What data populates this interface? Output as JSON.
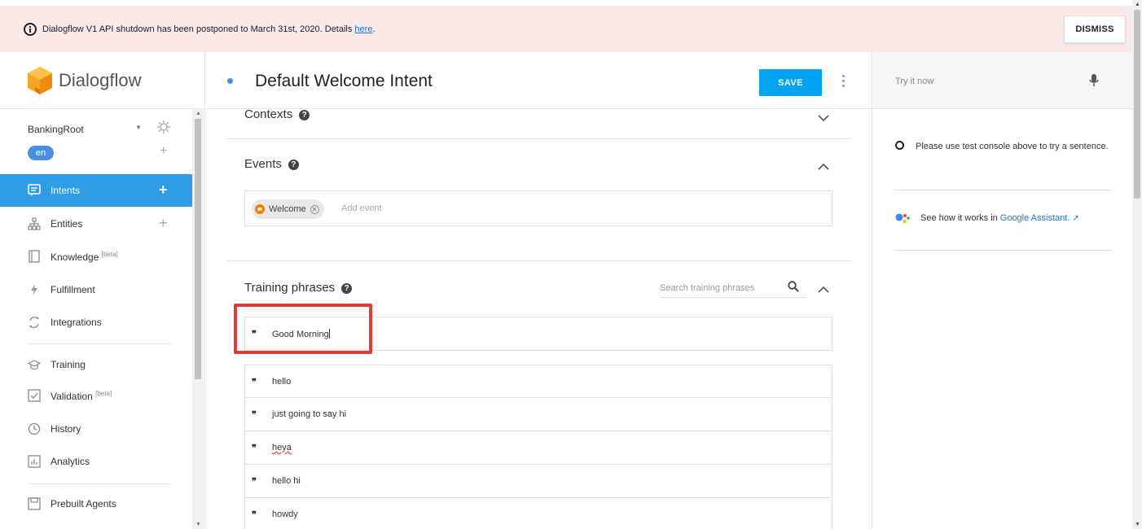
{
  "banner": {
    "message": "Dialogflow V1 API shutdown has been postponed to March 31st, 2020. Details",
    "link": "here",
    "dismiss": "DISMISS"
  },
  "sidebar": {
    "brand": "Dialogflow",
    "agent": "BankingRoot",
    "language": "en",
    "items": [
      {
        "label": "Intents",
        "icon": "intents-icon",
        "sup": ""
      },
      {
        "label": "Entities",
        "icon": "entities-icon",
        "sup": ""
      },
      {
        "label": "Knowledge",
        "icon": "knowledge-icon",
        "sup": "[beta]"
      },
      {
        "label": "Fulfillment",
        "icon": "fulfillment-icon",
        "sup": ""
      },
      {
        "label": "Integrations",
        "icon": "integrations-icon",
        "sup": ""
      },
      {
        "label": "Training",
        "icon": "training-icon",
        "sup": ""
      },
      {
        "label": "Validation",
        "icon": "validation-icon",
        "sup": "[beta]"
      },
      {
        "label": "History",
        "icon": "history-icon",
        "sup": ""
      },
      {
        "label": "Analytics",
        "icon": "analytics-icon",
        "sup": ""
      },
      {
        "label": "Prebuilt Agents",
        "icon": "prebuilt-icon",
        "sup": ""
      }
    ]
  },
  "header": {
    "title": "Default Welcome Intent",
    "save": "SAVE"
  },
  "sections": {
    "contexts": "Contexts",
    "events": "Events",
    "training": "Training phrases"
  },
  "events": {
    "chip": "Welcome",
    "placeholder": "Add event"
  },
  "training": {
    "search_placeholder": "Search training phrases",
    "input_value": "Good Morning",
    "phrases": [
      "hello",
      "just going to say hi",
      "heya",
      "hello hi",
      "howdy"
    ]
  },
  "right": {
    "try_placeholder": "Try it now",
    "note": "Please use test console above to try a sentence.",
    "ga_text": "See how it works in",
    "ga_link": "Google Assistant."
  },
  "colors": {
    "accent": "#2f9ce6",
    "save": "#00a4f0",
    "banner": "#fbe9e7",
    "highlight": "#e53935"
  }
}
